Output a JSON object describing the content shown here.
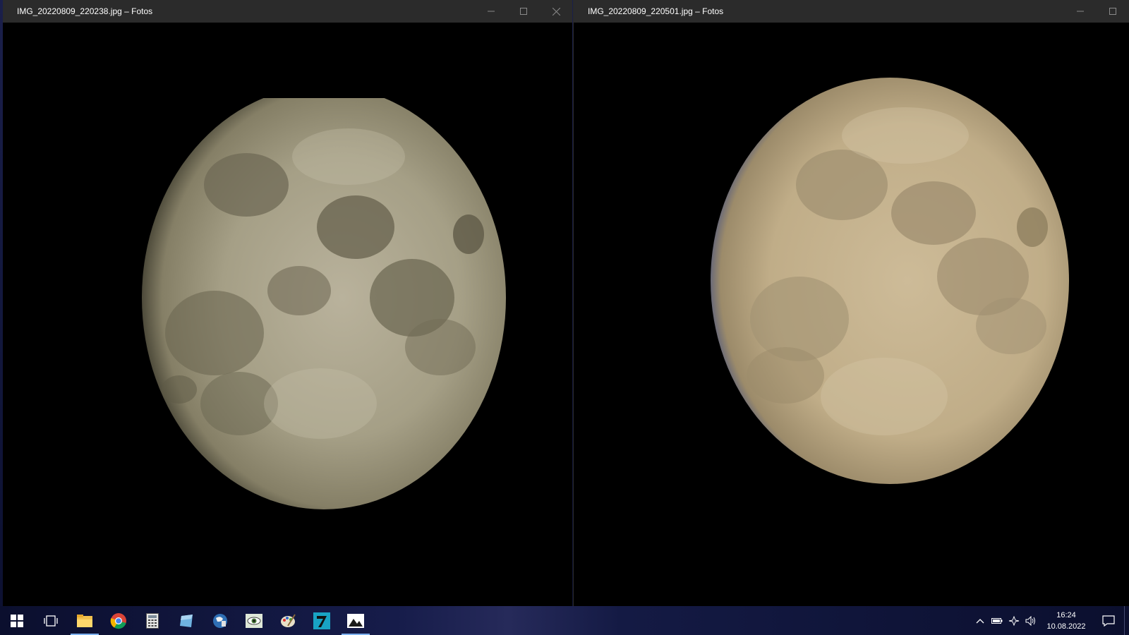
{
  "windows": [
    {
      "title": "IMG_20220809_220238.jpg – Fotos",
      "controls": [
        "minimize",
        "maximize",
        "close"
      ]
    },
    {
      "title": "IMG_20220809_220501.jpg – Fotos",
      "controls": [
        "minimize",
        "maximize"
      ]
    }
  ],
  "taskbar": {
    "apps": [
      {
        "name": "start-icon"
      },
      {
        "name": "task-view-icon"
      },
      {
        "name": "file-explorer-icon",
        "active": true
      },
      {
        "name": "chrome-icon"
      },
      {
        "name": "calculator-icon"
      },
      {
        "name": "app-icon-blue"
      },
      {
        "name": "app-icon-globe"
      },
      {
        "name": "app-icon-eye"
      },
      {
        "name": "app-icon-paint"
      },
      {
        "name": "app-icon-seven"
      },
      {
        "name": "photos-icon",
        "active": true
      }
    ],
    "tray": {
      "icons": [
        "chevron-up-icon",
        "battery-icon",
        "network-icon",
        "volume-icon"
      ],
      "time": "16:24",
      "date": "10.08.2022"
    }
  },
  "colors": {
    "titlebar": "#2b2b2b",
    "accent": "#7eb2f0"
  }
}
